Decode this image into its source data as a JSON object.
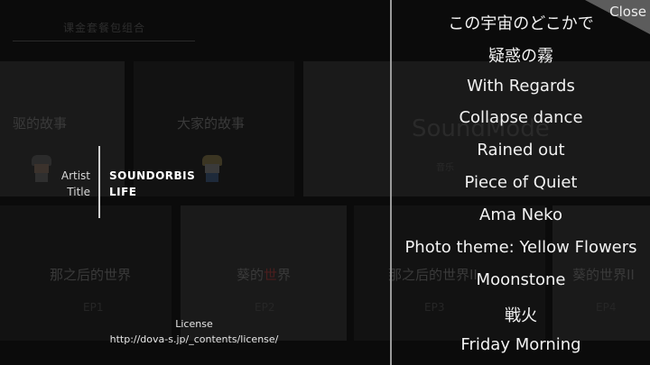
{
  "background": {
    "tab_label": "课金套餐包组合",
    "cards": [
      {
        "title": "驱的故事"
      },
      {
        "title": "大家的故事"
      },
      {
        "title_a": "那之后的世界",
        "ep": "EP1"
      },
      {
        "title_a": "葵的",
        "title_b": "世",
        "title_c": "界",
        "ep": "EP2"
      },
      {
        "title_a": "那之后的世界II",
        "ep": "EP3"
      },
      {
        "title_a": "葵的世界II",
        "ep": "EP4"
      }
    ],
    "sound_mode_label": "SoundMode",
    "sound_mode_sub": "音乐"
  },
  "now_playing": {
    "artist_label": "Artist",
    "title_label": "Title",
    "artist_value": "SOUNDORBIS",
    "title_value": "LIFE"
  },
  "license": {
    "label": "License",
    "url": "http://dova-s.jp/_contents/license/"
  },
  "close_label": "Close",
  "tracks": [
    "この宇宙のどこかで",
    "疑惑の霧",
    "With Regards",
    "Collapse dance",
    "Rained out",
    "Piece of Quiet",
    "Ama Neko",
    "Photo theme: Yellow Flowers",
    "Moonstone",
    "戦火",
    "Friday Morning"
  ]
}
